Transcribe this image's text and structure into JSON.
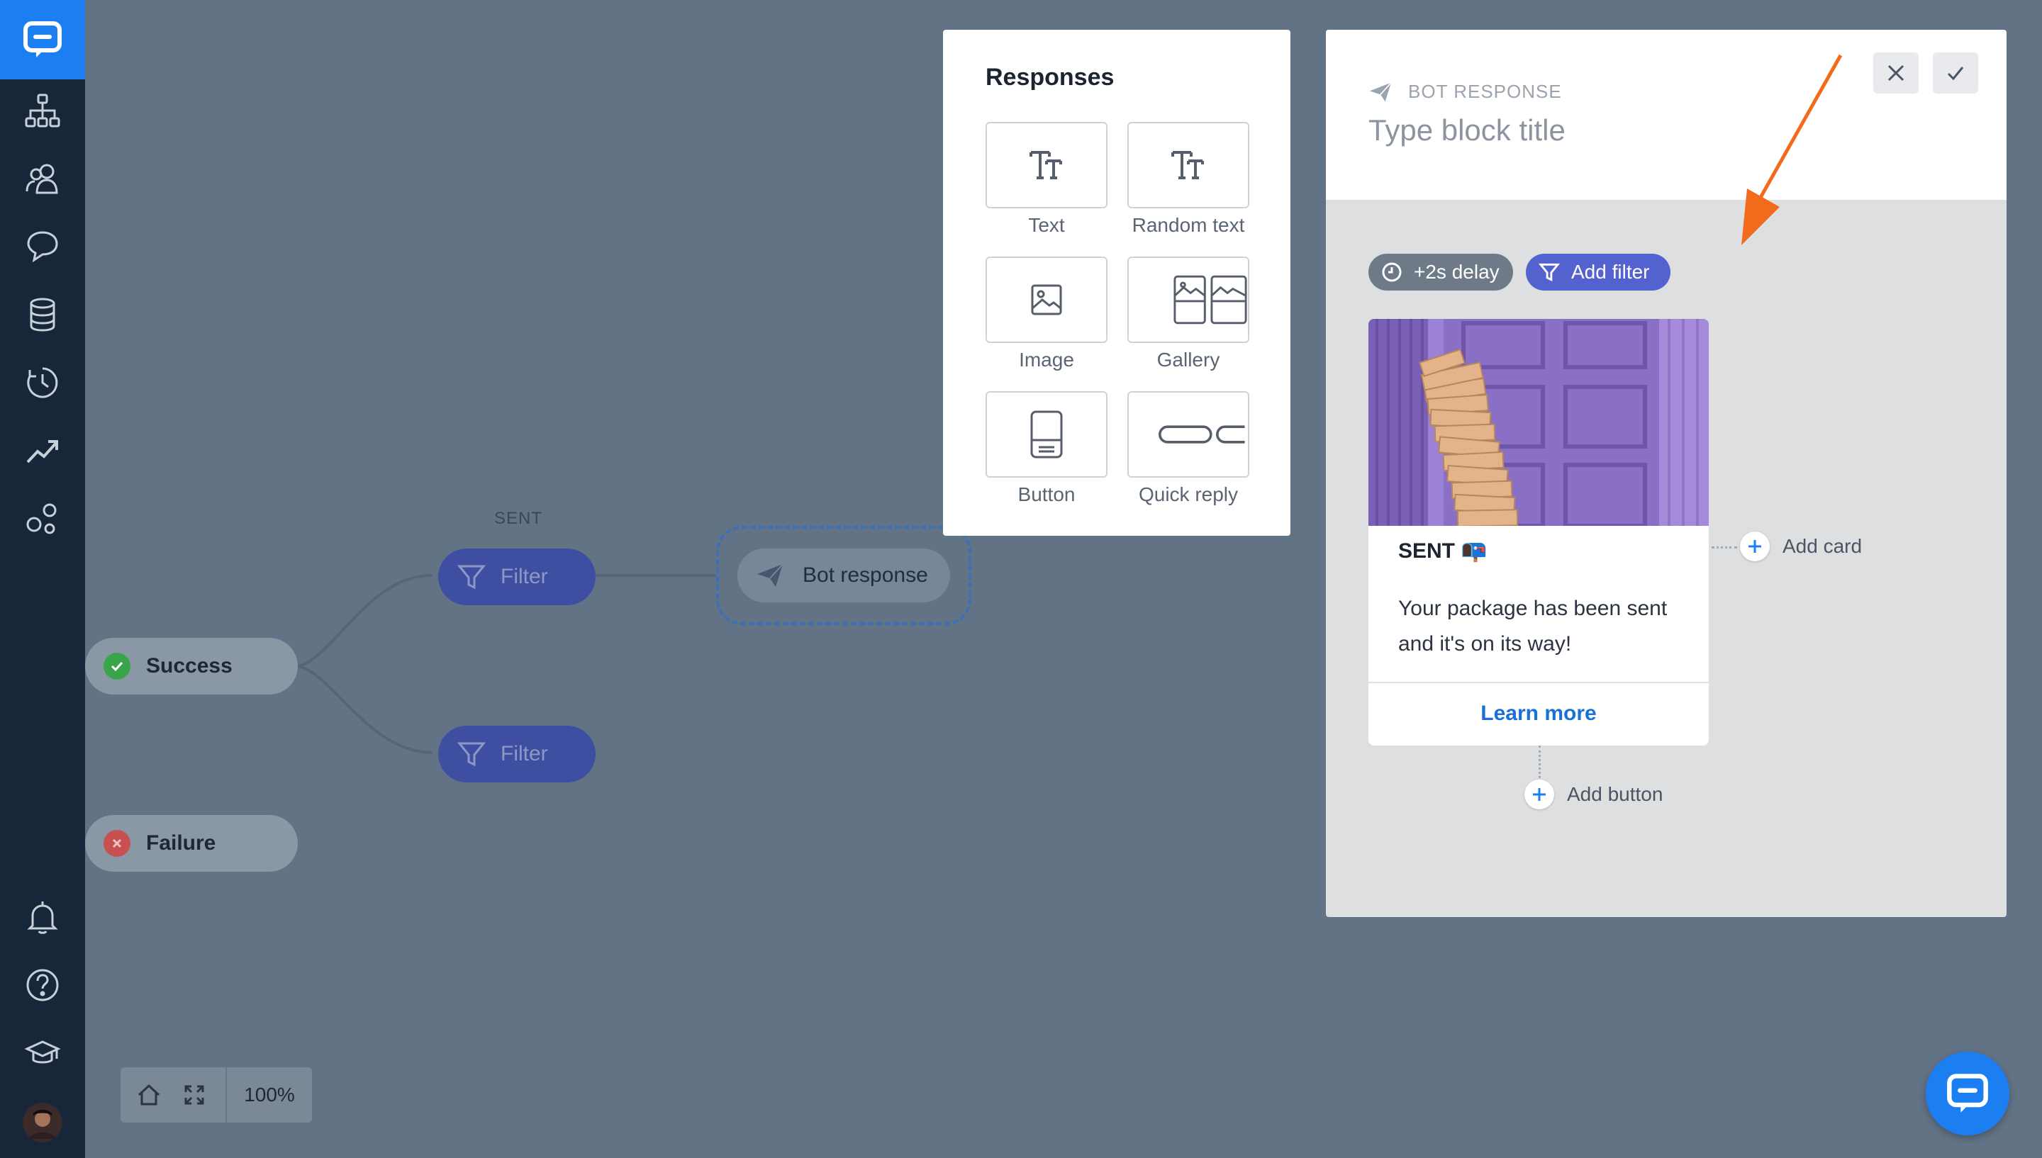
{
  "app": {
    "brand_color": "#1b7ff2",
    "sidebar_icons": [
      "chat-logo-icon",
      "sitemap-icon",
      "users-icon",
      "chat-bubble-icon",
      "database-icon",
      "history-icon",
      "analytics-icon",
      "integrations-icon",
      "bell-icon",
      "help-icon",
      "graduation-cap-icon",
      "user-avatar"
    ]
  },
  "graph": {
    "sent_label": "SENT",
    "success_label": "Success",
    "failure_label": "Failure",
    "filter_label_1": "Filter",
    "filter_label_2": "Filter",
    "bot_response_label": "Bot response"
  },
  "responses": {
    "title": "Responses",
    "items": [
      {
        "label": "Text",
        "icon": "text-icon"
      },
      {
        "label": "Random text",
        "icon": "random-text-icon"
      },
      {
        "label": "Image",
        "icon": "image-icon"
      },
      {
        "label": "Gallery",
        "icon": "gallery-icon"
      },
      {
        "label": "Button",
        "icon": "button-icon"
      },
      {
        "label": "Quick reply",
        "icon": "quick-reply-icon"
      }
    ]
  },
  "editor": {
    "kicker": "BOT RESPONSE",
    "title_placeholder": "Type block title",
    "delay_chip": "+2s delay",
    "filter_chip": "Add filter",
    "card": {
      "title": "SENT 📭",
      "body": "Your package has been sent and it's on its way!",
      "link": "Learn more"
    },
    "add_card": "Add card",
    "add_button": "Add button"
  },
  "zoom": {
    "level": "100%"
  }
}
